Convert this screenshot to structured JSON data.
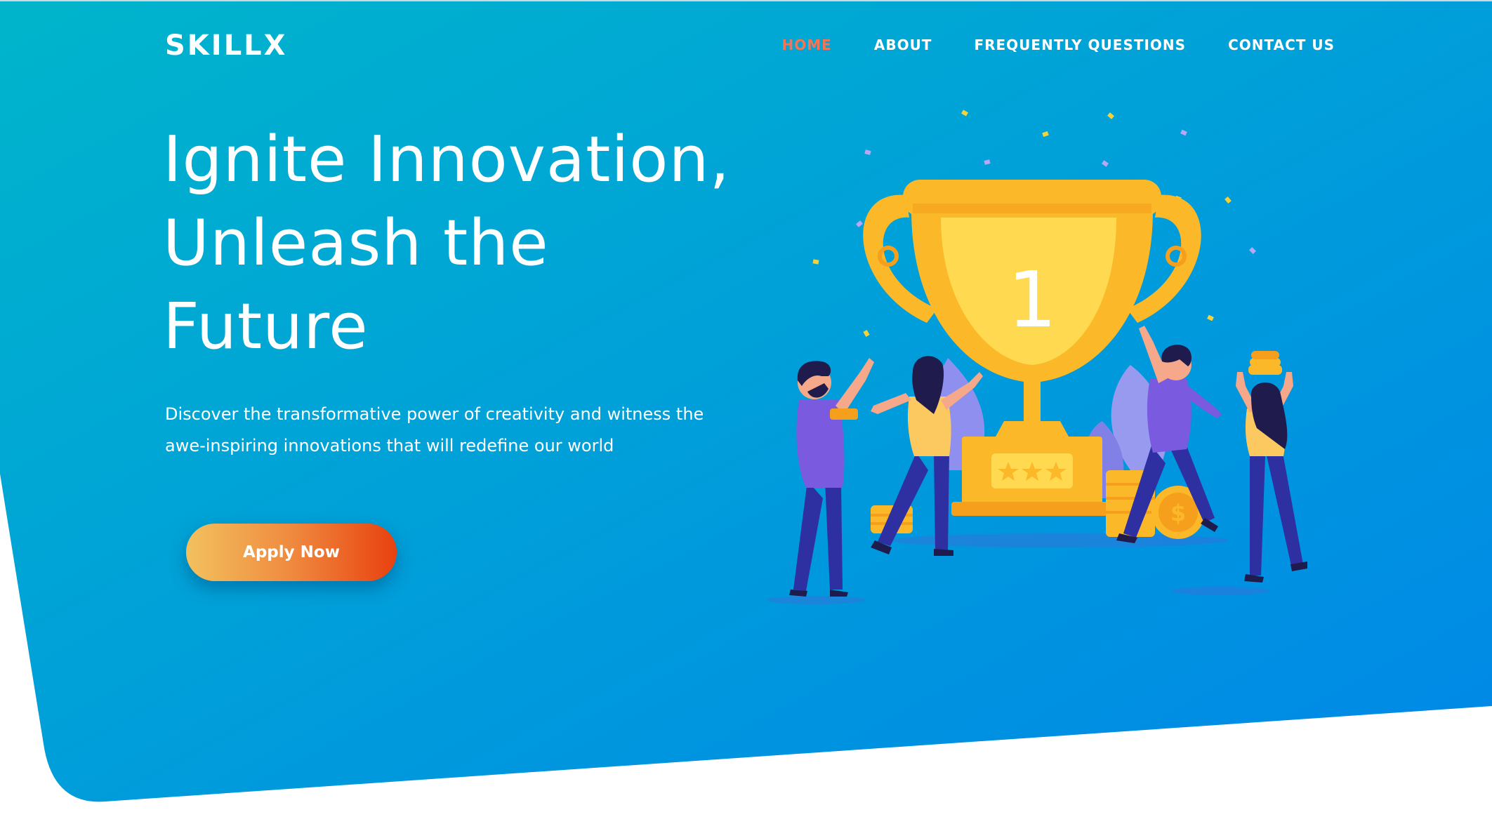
{
  "brand": {
    "name": "SKILLX"
  },
  "nav": {
    "items": [
      {
        "label": "HOME",
        "active": true
      },
      {
        "label": "ABOUT",
        "active": false
      },
      {
        "label": "FREQUENTLY QUESTIONS",
        "active": false
      },
      {
        "label": "CONTACT US",
        "active": false
      }
    ]
  },
  "hero": {
    "headline_lines": [
      "Ignite Innovation,",
      "Unleash the",
      "Future"
    ],
    "subtext": "Discover the transformative power of creativity and witness the awe-inspiring innovations that will redefine our world",
    "cta_label": "Apply Now",
    "trophy_number": "1"
  },
  "colors": {
    "hero_gradient_start": "#00b3cc",
    "hero_gradient_end": "#0085e6",
    "nav_active": "#f37558",
    "button_gradient_start": "#f2c15e",
    "button_gradient_end": "#e8410f",
    "trophy_gold": "#fbb829",
    "figure_purple": "#7a5be0",
    "pants_navy": "#2e2fa0"
  },
  "icons": [
    "trophy-illustration",
    "coin-icon",
    "star-icon",
    "confetti"
  ]
}
